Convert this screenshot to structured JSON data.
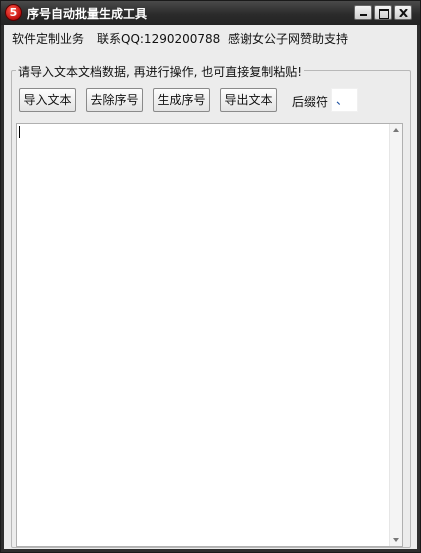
{
  "window": {
    "title": "序号自动批量生成工具",
    "icon": "app-logo-icon",
    "icon_glyph": "5"
  },
  "info": {
    "custom_software": "软件定制业务",
    "contact": "联系QQ:1290200788",
    "thanks": "感谢女公子网赞助支持"
  },
  "group": {
    "label": "请导入文本文档数据, 再进行操作, 也可直接复制粘贴!"
  },
  "toolbar": {
    "import_label": "导入文本",
    "remove_label": "去除序号",
    "generate_label": "生成序号",
    "export_label": "导出文本",
    "suffix_label": "后缀符",
    "suffix_value": "、"
  },
  "editor": {
    "content": ""
  }
}
